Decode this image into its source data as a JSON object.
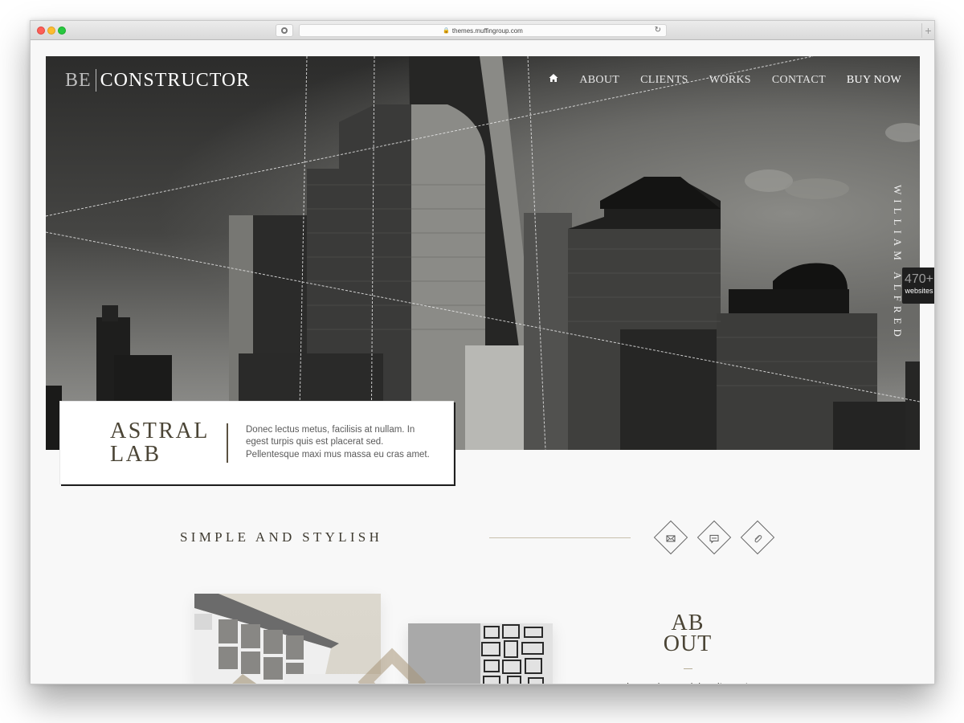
{
  "browser": {
    "url": "themes.muffingroup.com",
    "new_tab_label": "+"
  },
  "header": {
    "logo_prefix": "BE",
    "logo_name": "CONSTRUCTOR",
    "nav": [
      {
        "label": "ABOUT"
      },
      {
        "label": "CLIENTS"
      },
      {
        "label": "WORKS"
      },
      {
        "label": "CONTACT"
      },
      {
        "label": "BUY NOW"
      }
    ],
    "home_icon": "home-icon"
  },
  "hero": {
    "side_name": "WILLIAM ALFRED",
    "card_title_line1": "ASTRAL",
    "card_title_line2": "LAB",
    "card_text": "Donec lectus metus, facilisis at nullam. In egest turpis quis est placerat sed. Pellentesque maxi mus massa eu cras amet."
  },
  "badge": {
    "count": "470+",
    "label": "websites"
  },
  "section": {
    "title": "SIMPLE AND STYLISH",
    "icons": [
      "envelope-icon",
      "chat-icon",
      "paperclip-icon"
    ]
  },
  "about": {
    "title_line1": "AB",
    "title_line2": "OUT",
    "text": "Lorem ipsum dolor sit amet, consectetur adipisicing elit, sed"
  },
  "colors": {
    "accent_brown": "#4b4536",
    "line_beige": "#c8bfac",
    "badge_bg": "#1f1f1f"
  }
}
